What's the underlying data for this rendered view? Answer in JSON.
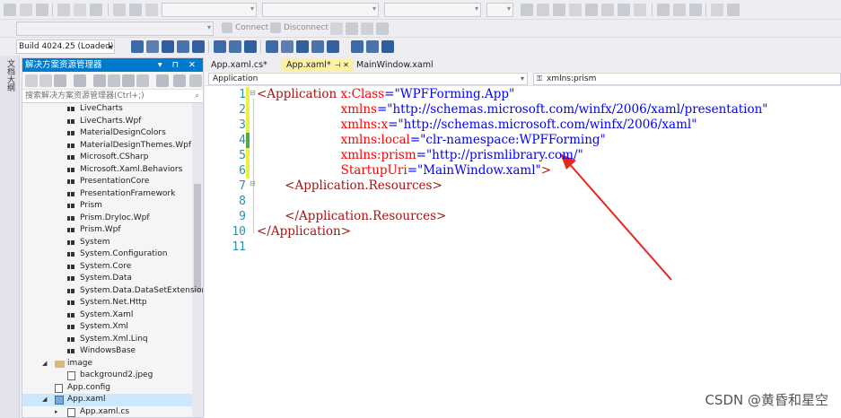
{
  "toolbar": {
    "connect_label": "Connect",
    "disconnect_label": "Disconnect",
    "build_combo": "Build 4024.25 (Loaded)"
  },
  "side_strip": {
    "label": "文档大纲"
  },
  "solution_explorer": {
    "title": "解决方案资源管理器",
    "title_buttons": "▾ ⊓ ✕",
    "search_placeholder": "搜索解决方案资源管理器(Ctrl+;)",
    "search_icon": "search-icon",
    "references": [
      "LiveCharts",
      "LiveCharts.Wpf",
      "MaterialDesignColors",
      "MaterialDesignThemes.Wpf",
      "Microsoft.CSharp",
      "Microsoft.Xaml.Behaviors",
      "PresentationCore",
      "PresentationFramework",
      "Prism",
      "Prism.DryIoc.Wpf",
      "Prism.Wpf",
      "System",
      "System.Configuration",
      "System.Core",
      "System.Data",
      "System.Data.DataSetExtensions",
      "System.Net.Http",
      "System.Xaml",
      "System.Xml",
      "System.Xml.Linq",
      "WindowsBase"
    ],
    "folder_image": "image",
    "file_background": "background2.jpeg",
    "file_appconfig": "App.config",
    "file_appxaml": "App.xaml",
    "file_appxamlcs": "App.xaml.cs"
  },
  "tabs": [
    {
      "label": "App.xaml.cs*",
      "active": false
    },
    {
      "label": "App.xaml*",
      "active": true,
      "pin": "⊣ ✕"
    },
    {
      "label": "MainWindow.xaml",
      "active": false
    }
  ],
  "nav": {
    "left_combo": "Application",
    "right_combo": "xmlns:prism"
  },
  "editor": {
    "line_numbers": [
      "1",
      "2",
      "3",
      "4",
      "5",
      "6",
      "7",
      "8",
      "9",
      "10",
      "11"
    ],
    "lines": [
      [
        [
          "brown",
          "<Application "
        ],
        [
          "red",
          "x:Class"
        ],
        [
          "blue",
          "=\"WPFForming.App\""
        ]
      ],
      [
        [
          "red",
          "xmlns"
        ],
        [
          "blue",
          "=\"http://schemas.microsoft.com/winfx/2006/xaml/presentation\""
        ]
      ],
      [
        [
          "red",
          "xmlns:x"
        ],
        [
          "blue",
          "=\"http://schemas.microsoft.com/winfx/2006/xaml\""
        ]
      ],
      [
        [
          "red",
          "xmlns:local"
        ],
        [
          "blue",
          "=\"clr-namespace:WPFForming\""
        ]
      ],
      [
        [
          "red",
          "xmlns:prism"
        ],
        [
          "blue",
          "=\"http://prismlibrary.com/\""
        ]
      ],
      [
        [
          "red",
          "StartupUri"
        ],
        [
          "blue",
          "=\"MainWindow.xaml\""
        ],
        [
          "brown",
          ">"
        ]
      ],
      [
        [
          "brown",
          "<Application.Resources>"
        ]
      ],
      [],
      [
        [
          "brown",
          "</Application.Resources>"
        ]
      ],
      [
        [
          "brown",
          "</Application>"
        ]
      ],
      []
    ],
    "colors": {
      "blue": "#0000ff",
      "brown": "#a31515",
      "red": "#ff0000",
      "linenum": "#2b91af",
      "change_yellow": "#efef40",
      "change_green": "#57a64a"
    },
    "annotation_arrow_color": "#e8261e"
  },
  "watermark": "CSDN @黄昏和星空"
}
